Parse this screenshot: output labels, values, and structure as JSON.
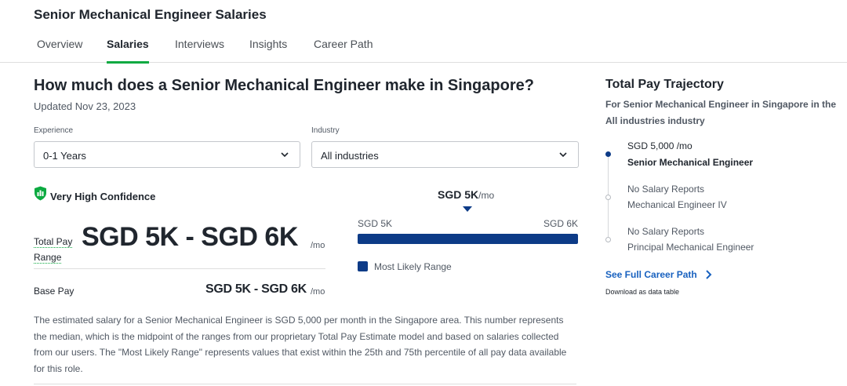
{
  "header": {
    "job_title": "Senior Mechanical Engineer Salaries",
    "tabs": [
      {
        "label": "Overview",
        "active": false
      },
      {
        "label": "Salaries",
        "active": true
      },
      {
        "label": "Interviews",
        "active": false
      },
      {
        "label": "Insights",
        "active": false
      },
      {
        "label": "Career Path",
        "active": false
      }
    ]
  },
  "main": {
    "heading": "How much does a Senior Mechanical Engineer make in Singapore?",
    "updated": "Updated Nov 23, 2023",
    "filters": {
      "experience": {
        "label": "Experience",
        "value": "0-1 Years"
      },
      "industry": {
        "label": "Industry",
        "value": "All industries"
      }
    },
    "confidence": {
      "label": "Very High Confidence",
      "icon": "shield-check-icon",
      "color": "#0caa41"
    },
    "total_pay": {
      "label": "Total Pay Range",
      "value": "SGD 5K - SGD 6K",
      "unit": "/mo"
    },
    "base_pay": {
      "label": "Base Pay",
      "value": "SGD 5K - SGD 6K",
      "unit": "/mo"
    },
    "range_chart": {
      "median_value": "SGD 5K",
      "median_unit": "/mo",
      "low_label": "SGD 5K",
      "high_label": "SGD 6K",
      "legend": "Most Likely Range",
      "bar_color": "#0d3b87"
    },
    "description": "The estimated salary for a Senior Mechanical Engineer is SGD 5,000 per month in the Singapore area. This number represents the median, which is the midpoint of the ranges from our proprietary Total Pay Estimate model and based on salaries collected from our users. The \"Most Likely Range\" represents values that exist within the 25th and 75th percentile of all pay data available for this role."
  },
  "trajectory": {
    "title": "Total Pay Trajectory",
    "subtitle": "For Senior Mechanical Engineer in Singapore in the All industries industry",
    "steps": [
      {
        "pay": "SGD 5,000 /mo",
        "role": "Senior Mechanical Engineer",
        "active": true
      },
      {
        "pay": "No Salary Reports",
        "role": "Mechanical Engineer IV",
        "active": false
      },
      {
        "pay": "No Salary Reports",
        "role": "Principal Mechanical Engineer",
        "active": false
      }
    ],
    "career_link": "See Full Career Path",
    "download_link": "Download as data table"
  },
  "colors": {
    "accent_green": "#0caa41",
    "navy": "#0d3b87",
    "link_blue": "#1861bf"
  }
}
